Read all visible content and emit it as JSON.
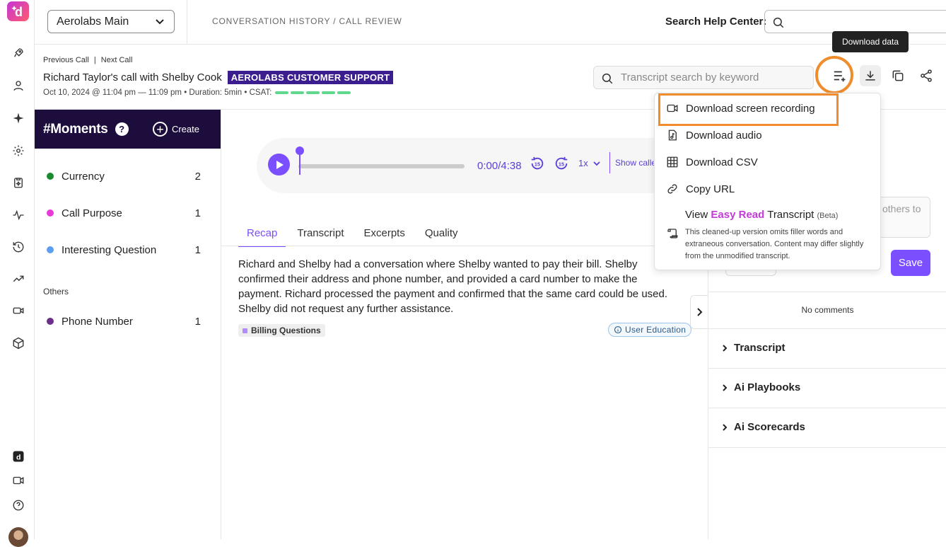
{
  "topbar": {
    "workspace": "Aerolabs Main",
    "breadcrumb": "CONVERSATION HISTORY / CALL REVIEW",
    "help_label": "Search Help Center:",
    "help_placeholder": ""
  },
  "header": {
    "prev_call": "Previous Call",
    "separator": "|",
    "next_call": "Next Call",
    "call_title": "Richard Taylor's call with Shelby Cook",
    "team_badge": "AEROLABS CUSTOMER SUPPORT",
    "meta": "Oct 10, 2024 @ 11:04 pm — 11:09 pm • Duration: 5min • CSAT:",
    "transcript_search_placeholder": "Transcript search by keyword",
    "tooltip": "Download data"
  },
  "download_menu": {
    "items": [
      {
        "label": "Download screen recording",
        "icon": "video-icon"
      },
      {
        "label": "Download audio",
        "icon": "audio-file-icon"
      },
      {
        "label": "Download CSV",
        "icon": "table-icon"
      },
      {
        "label": "Copy URL",
        "icon": "link-icon"
      }
    ],
    "easy_read": {
      "prefix": "View ",
      "highlight": "Easy Read",
      "suffix": " Transcript ",
      "beta": "(Beta)",
      "description": "This cleaned-up version omits filler words and extraneous conversation. Content may differ slightly from the unmodified transcript."
    }
  },
  "moments": {
    "title": "#Moments",
    "help": "?",
    "create_label": "Create",
    "items": [
      {
        "label": "Currency",
        "count": "2",
        "color": "#1a8a2e"
      },
      {
        "label": "Call Purpose",
        "count": "1",
        "color": "#e83ad8"
      },
      {
        "label": "Interesting Question",
        "count": "1",
        "color": "#5b9ef0"
      }
    ],
    "others_label": "Others",
    "other_items": [
      {
        "label": "Phone Number",
        "count": "1",
        "color": "#6b2f8a"
      }
    ]
  },
  "player": {
    "time": "0:00/4:38",
    "skip_back": "15",
    "skip_forward": "15",
    "speed": "1x",
    "show_caller": "Show caller"
  },
  "tabs": [
    "Recap",
    "Transcript",
    "Excerpts",
    "Quality"
  ],
  "recap": {
    "text": "Richard and Shelby had a conversation where Shelby wanted to pay their bill. Shelby confirmed their address and phone number, and provided a card number to make the payment. Richard processed the payment and confirmed that the same card could be used. Shelby did not request any further assistance.",
    "tag": "Billing Questions",
    "tag2": "User Education"
  },
  "right_panel": {
    "comment_placeholder": "others to",
    "save_label": "Save",
    "no_comments": "No comments",
    "sections": [
      "Transcript",
      "Ai Playbooks",
      "Ai Scorecards"
    ]
  },
  "colors": {
    "accent": "#7b4fff",
    "highlight": "#f08c2c",
    "moments_header": "#1c0d3d",
    "team_badge": "#3b1d8f"
  }
}
